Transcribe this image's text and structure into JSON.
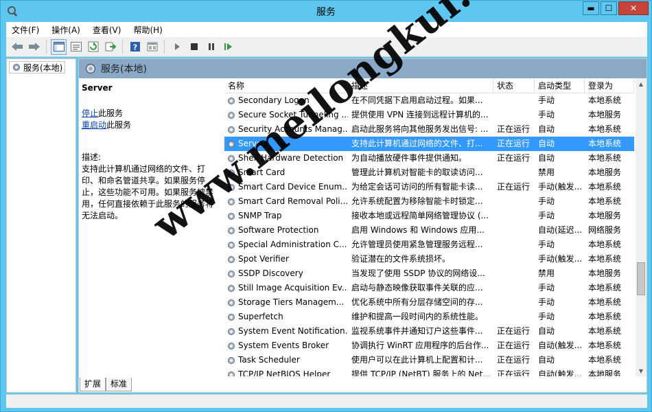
{
  "window": {
    "title": "服务",
    "buttons": {
      "minimize": "▬",
      "maximize": "☐",
      "close": "✕"
    }
  },
  "menu": [
    {
      "label": "文件(F)"
    },
    {
      "label": "操作(A)"
    },
    {
      "label": "查看(V)"
    },
    {
      "label": "帮助(H)"
    }
  ],
  "toolbar": {
    "icons": [
      "back-icon",
      "forward-icon",
      "show-tree-icon",
      "properties-icon",
      "refresh-icon",
      "export-icon",
      "help-icon",
      "view-icon",
      "play-icon",
      "stop-icon",
      "pause-icon",
      "resume-icon"
    ]
  },
  "tree": {
    "item": "服务(本地)"
  },
  "header": {
    "title": "服务(本地)"
  },
  "detail": {
    "service_name": "Server",
    "stop_link": "停止",
    "stop_text": "此服务",
    "restart_link": "重启动",
    "restart_text": "此服务",
    "desc_label": "描述:",
    "desc_text": "支持此计算机通过网络的文件、打印、和命名管道共享。如果服务停止，这些功能不可用。如果服务被禁用，任何直接依赖于此服务的服务将无法启动。"
  },
  "columns": {
    "name": "名称",
    "desc": "描述",
    "status": "状态",
    "start": "启动类型",
    "logon": "登录为"
  },
  "rows": [
    {
      "name": "Secondary Logon",
      "desc": "在不同凭据下启用启动过程。如果...",
      "status": "",
      "start": "手动",
      "logon": "本地系统"
    },
    {
      "name": "Secure Socket Tunneling ...",
      "desc": "提供使用 VPN 连接到远程计算机的...",
      "status": "",
      "start": "手动",
      "logon": "本地服务"
    },
    {
      "name": "Security Accounts Manag...",
      "desc": "启动此服务将向其他服务发出信号: ...",
      "status": "正在运行",
      "start": "自动",
      "logon": "本地系统"
    },
    {
      "name": "Server",
      "desc": "支持此计算机通过网络的文件、打...",
      "status": "正在运行",
      "start": "自动",
      "logon": "本地系统",
      "selected": true
    },
    {
      "name": "Shell Hardware Detection",
      "desc": "为自动播放硬件事件提供通知。",
      "status": "正在运行",
      "start": "自动",
      "logon": "本地系统"
    },
    {
      "name": "Smart Card",
      "desc": "管理此计算机对智能卡的取读访问...",
      "status": "",
      "start": "禁用",
      "logon": "本地服务"
    },
    {
      "name": "Smart Card Device Enum...",
      "desc": "为给定会话可访问的所有智能卡读...",
      "status": "正在运行",
      "start": "手动(触发...",
      "logon": "本地系统"
    },
    {
      "name": "Smart Card Removal Poli...",
      "desc": "允许系统配置为移除智能卡时锁定...",
      "status": "",
      "start": "手动",
      "logon": "本地系统"
    },
    {
      "name": "SNMP Trap",
      "desc": "接收本地或远程简单网络管理协议 (...",
      "status": "",
      "start": "手动",
      "logon": "本地服务"
    },
    {
      "name": "Software Protection",
      "desc": "启用 Windows 和 Windows 应用...",
      "status": "",
      "start": "自动(延迟...",
      "logon": "网络服务"
    },
    {
      "name": "Special Administration C...",
      "desc": "允许管理员使用紧急管理服务远程...",
      "status": "",
      "start": "手动",
      "logon": "本地系统"
    },
    {
      "name": "Spot Verifier",
      "desc": "验证潜在的文件系统损坏。",
      "status": "",
      "start": "手动(触发...",
      "logon": "本地系统"
    },
    {
      "name": "SSDP Discovery",
      "desc": "当发现了使用 SSDP 协议的网络设...",
      "status": "",
      "start": "禁用",
      "logon": "本地服务"
    },
    {
      "name": "Still Image Acquisition Ev...",
      "desc": "启动与静态映像获取事件关联的应...",
      "status": "",
      "start": "手动",
      "logon": "本地系统"
    },
    {
      "name": "Storage Tiers Managem...",
      "desc": "优化系统中所有分层存储空间的存...",
      "status": "",
      "start": "手动",
      "logon": "本地系统"
    },
    {
      "name": "Superfetch",
      "desc": "维护和提高一段时间内的系统性能。",
      "status": "",
      "start": "手动",
      "logon": "本地系统"
    },
    {
      "name": "System Event Notification...",
      "desc": "监视系统事件并通知订户这些事件...",
      "status": "正在运行",
      "start": "自动",
      "logon": "本地系统"
    },
    {
      "name": "System Events Broker",
      "desc": "协调执行 WinRT 应用程序的后台作...",
      "status": "正在运行",
      "start": "自动(触发...",
      "logon": "本地系统"
    },
    {
      "name": "Task Scheduler",
      "desc": "使用户可以在此计算机上配置和计...",
      "status": "正在运行",
      "start": "自动",
      "logon": "本地系统"
    },
    {
      "name": "TCP/IP NetBIOS Helper",
      "desc": "提供 TCP/IP (NetBT) 服务上的 Net...",
      "status": "正在运行",
      "start": "自动(触发...",
      "logon": "本地服务"
    }
  ],
  "tabs": [
    {
      "label": "扩展"
    },
    {
      "label": "标准"
    }
  ],
  "watermark": "www.meilongkui.com"
}
